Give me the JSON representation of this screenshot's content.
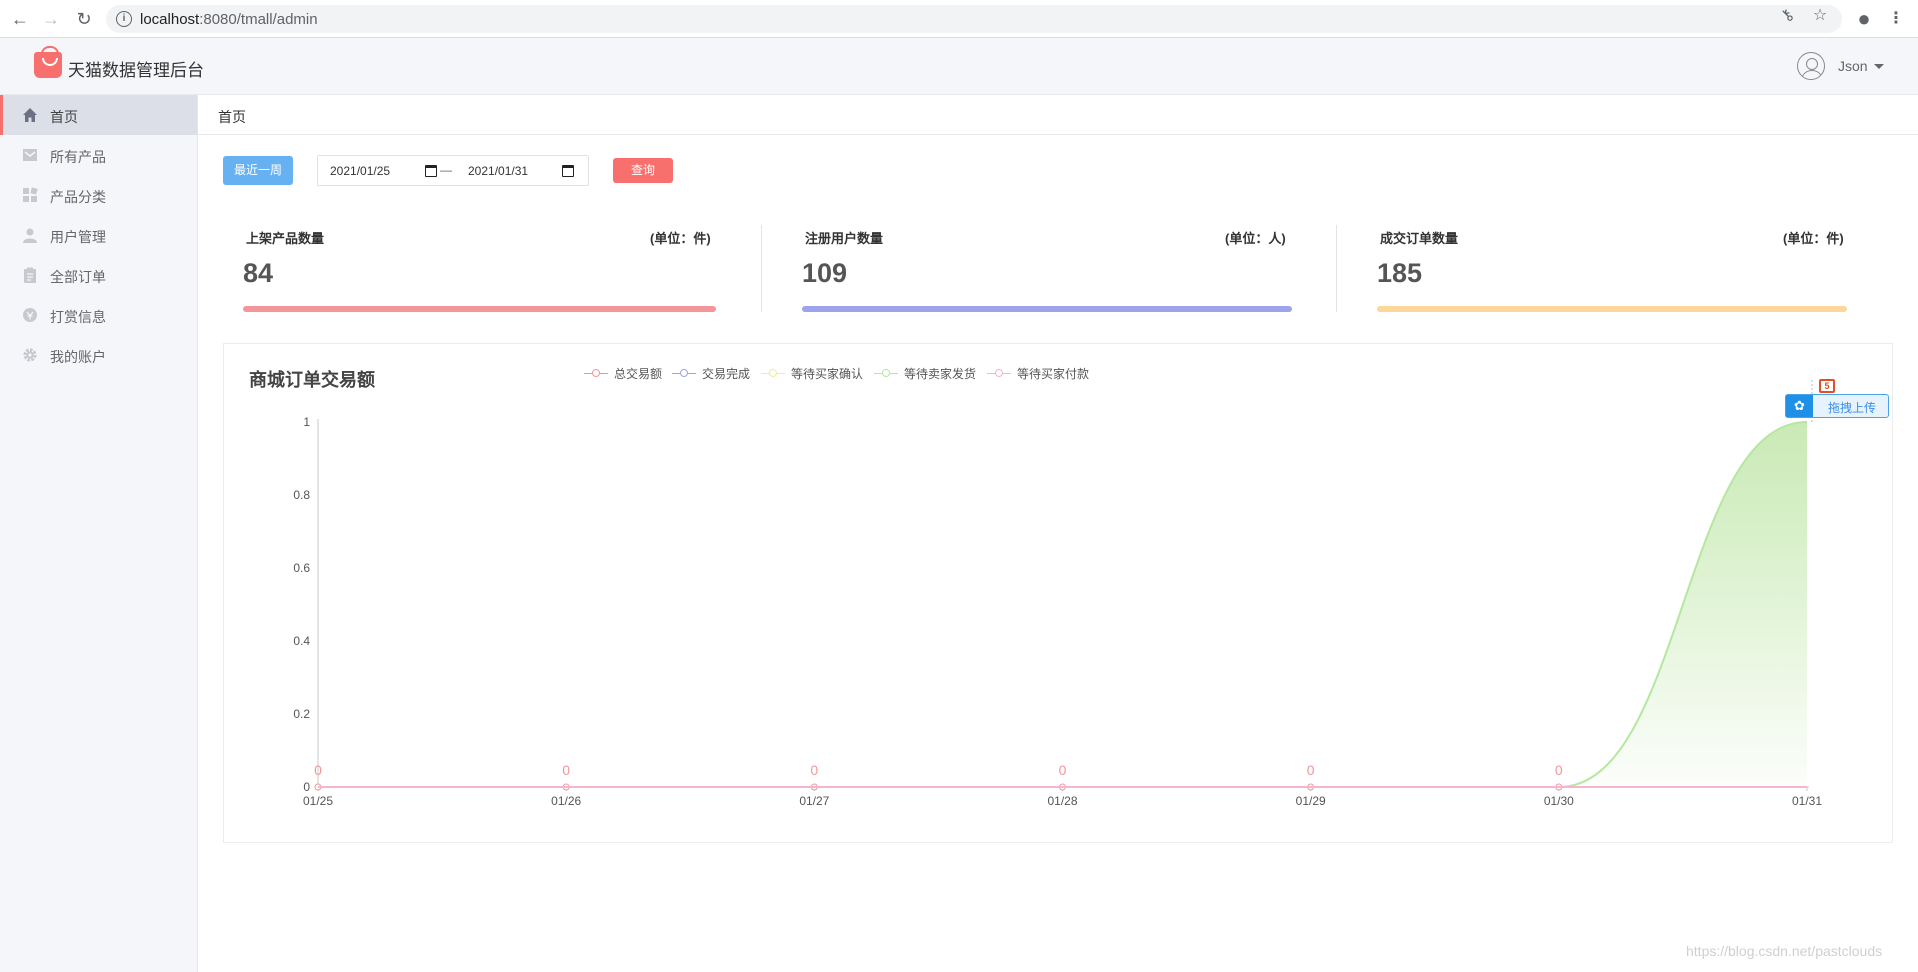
{
  "browser": {
    "url_host": "localhost",
    "url_path": ":8080/tmall/admin"
  },
  "header": {
    "title": "天猫数据管理后台",
    "user": "Json"
  },
  "sidebar": {
    "items": [
      {
        "label": "首页",
        "icon": "home-icon",
        "active": true
      },
      {
        "label": "所有产品",
        "icon": "product-icon"
      },
      {
        "label": "产品分类",
        "icon": "category-icon"
      },
      {
        "label": "用户管理",
        "icon": "user-icon"
      },
      {
        "label": "全部订单",
        "icon": "order-icon"
      },
      {
        "label": "打赏信息",
        "icon": "reward-icon"
      },
      {
        "label": "我的账户",
        "icon": "gear-icon"
      }
    ]
  },
  "breadcrumb": "首页",
  "filters": {
    "week_button": "最近一周",
    "start_date": "2021/01/25",
    "end_date": "2021/01/31",
    "separator": "—",
    "query_button": "查询"
  },
  "stats": [
    {
      "label": "上架产品数量",
      "unit": "(单位：件)",
      "value": "84",
      "color": "#f4959a"
    },
    {
      "label": "注册用户数量",
      "unit": "(单位：人)",
      "value": "109",
      "color": "#9ea3ec"
    },
    {
      "label": "成交订单数量",
      "unit": "(单位：件)",
      "value": "185",
      "color": "#fdd79a"
    }
  ],
  "chart": {
    "title": "商城订单交易额",
    "upload_label": "拖拽上传"
  },
  "chart_data": {
    "type": "line",
    "categories": [
      "01/25",
      "01/26",
      "01/27",
      "01/28",
      "01/29",
      "01/30",
      "01/31"
    ],
    "ylim": [
      0,
      1
    ],
    "yticks": [
      "0",
      "0.2",
      "0.4",
      "0.6",
      "0.8",
      "1"
    ],
    "grid": false,
    "legend_position": "top",
    "series": [
      {
        "name": "总交易额",
        "color": "#f4959a",
        "values": [
          0,
          0,
          0,
          0,
          0,
          0,
          0
        ],
        "labels": true
      },
      {
        "name": "交易完成",
        "color": "#9ea3ec",
        "values": [
          0,
          0,
          0,
          0,
          0,
          0,
          0
        ]
      },
      {
        "name": "等待买家确认",
        "color": "#f6e9a0",
        "values": [
          0,
          0,
          0,
          0,
          0,
          0,
          0
        ]
      },
      {
        "name": "等待卖家发货",
        "color": "#b6e7a0",
        "values": [
          0,
          0,
          0,
          0,
          0,
          0,
          1
        ],
        "area": true
      },
      {
        "name": "等待买家付款",
        "color": "#f3b5d0",
        "values": [
          0,
          0,
          0,
          0,
          0,
          0,
          0
        ]
      }
    ]
  },
  "watermark": "https://blog.csdn.net/pastclouds"
}
